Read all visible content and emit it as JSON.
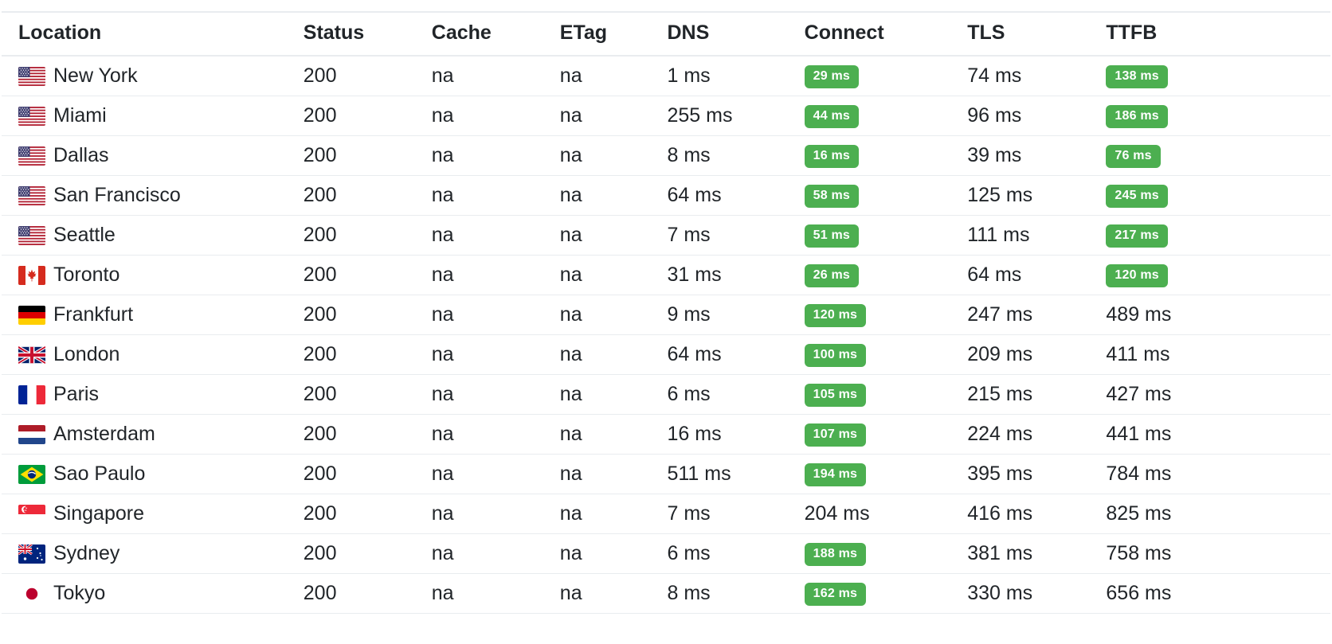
{
  "table": {
    "columns": [
      {
        "key": "location",
        "label": "Location"
      },
      {
        "key": "status",
        "label": "Status"
      },
      {
        "key": "cache",
        "label": "Cache"
      },
      {
        "key": "etag",
        "label": "ETag"
      },
      {
        "key": "dns",
        "label": "DNS"
      },
      {
        "key": "connect",
        "label": "Connect"
      },
      {
        "key": "tls",
        "label": "TLS"
      },
      {
        "key": "ttfb",
        "label": "TTFB"
      }
    ],
    "colors": {
      "badge_green": "#4caf50",
      "badge_text": "#ffffff",
      "text": "#212529",
      "row_border": "#e9ecef",
      "background": "#ffffff"
    },
    "rows": [
      {
        "flag": "flag-us",
        "location": "New York",
        "status": "200",
        "cache": "na",
        "etag": "na",
        "dns": "1 ms",
        "connect": "29 ms",
        "connect_badge": true,
        "tls": "74 ms",
        "ttfb": "138 ms",
        "ttfb_badge": true
      },
      {
        "flag": "flag-us",
        "location": "Miami",
        "status": "200",
        "cache": "na",
        "etag": "na",
        "dns": "255 ms",
        "connect": "44 ms",
        "connect_badge": true,
        "tls": "96 ms",
        "ttfb": "186 ms",
        "ttfb_badge": true
      },
      {
        "flag": "flag-us",
        "location": "Dallas",
        "status": "200",
        "cache": "na",
        "etag": "na",
        "dns": "8 ms",
        "connect": "16 ms",
        "connect_badge": true,
        "tls": "39 ms",
        "ttfb": "76 ms",
        "ttfb_badge": true
      },
      {
        "flag": "flag-us",
        "location": "San Francisco",
        "status": "200",
        "cache": "na",
        "etag": "na",
        "dns": "64 ms",
        "connect": "58 ms",
        "connect_badge": true,
        "tls": "125 ms",
        "ttfb": "245 ms",
        "ttfb_badge": true
      },
      {
        "flag": "flag-us",
        "location": "Seattle",
        "status": "200",
        "cache": "na",
        "etag": "na",
        "dns": "7 ms",
        "connect": "51 ms",
        "connect_badge": true,
        "tls": "111 ms",
        "ttfb": "217 ms",
        "ttfb_badge": true
      },
      {
        "flag": "flag-ca",
        "location": "Toronto",
        "status": "200",
        "cache": "na",
        "etag": "na",
        "dns": "31 ms",
        "connect": "26 ms",
        "connect_badge": true,
        "tls": "64 ms",
        "ttfb": "120 ms",
        "ttfb_badge": true
      },
      {
        "flag": "flag-de",
        "location": "Frankfurt",
        "status": "200",
        "cache": "na",
        "etag": "na",
        "dns": "9 ms",
        "connect": "120 ms",
        "connect_badge": true,
        "tls": "247 ms",
        "ttfb": "489 ms",
        "ttfb_badge": false
      },
      {
        "flag": "flag-gb",
        "location": "London",
        "status": "200",
        "cache": "na",
        "etag": "na",
        "dns": "64 ms",
        "connect": "100 ms",
        "connect_badge": true,
        "tls": "209 ms",
        "ttfb": "411 ms",
        "ttfb_badge": false
      },
      {
        "flag": "flag-fr",
        "location": "Paris",
        "status": "200",
        "cache": "na",
        "etag": "na",
        "dns": "6 ms",
        "connect": "105 ms",
        "connect_badge": true,
        "tls": "215 ms",
        "ttfb": "427 ms",
        "ttfb_badge": false
      },
      {
        "flag": "flag-nl",
        "location": "Amsterdam",
        "status": "200",
        "cache": "na",
        "etag": "na",
        "dns": "16 ms",
        "connect": "107 ms",
        "connect_badge": true,
        "tls": "224 ms",
        "ttfb": "441 ms",
        "ttfb_badge": false
      },
      {
        "flag": "flag-br",
        "location": "Sao Paulo",
        "status": "200",
        "cache": "na",
        "etag": "na",
        "dns": "511 ms",
        "connect": "194 ms",
        "connect_badge": true,
        "tls": "395 ms",
        "ttfb": "784 ms",
        "ttfb_badge": false
      },
      {
        "flag": "flag-sg",
        "location": "Singapore",
        "status": "200",
        "cache": "na",
        "etag": "na",
        "dns": "7 ms",
        "connect": "204 ms",
        "connect_badge": false,
        "tls": "416 ms",
        "ttfb": "825 ms",
        "ttfb_badge": false
      },
      {
        "flag": "flag-au",
        "location": "Sydney",
        "status": "200",
        "cache": "na",
        "etag": "na",
        "dns": "6 ms",
        "connect": "188 ms",
        "connect_badge": true,
        "tls": "381 ms",
        "ttfb": "758 ms",
        "ttfb_badge": false
      },
      {
        "flag": "flag-jp",
        "location": "Tokyo",
        "status": "200",
        "cache": "na",
        "etag": "na",
        "dns": "8 ms",
        "connect": "162 ms",
        "connect_badge": true,
        "tls": "330 ms",
        "ttfb": "656 ms",
        "ttfb_badge": false
      }
    ]
  }
}
